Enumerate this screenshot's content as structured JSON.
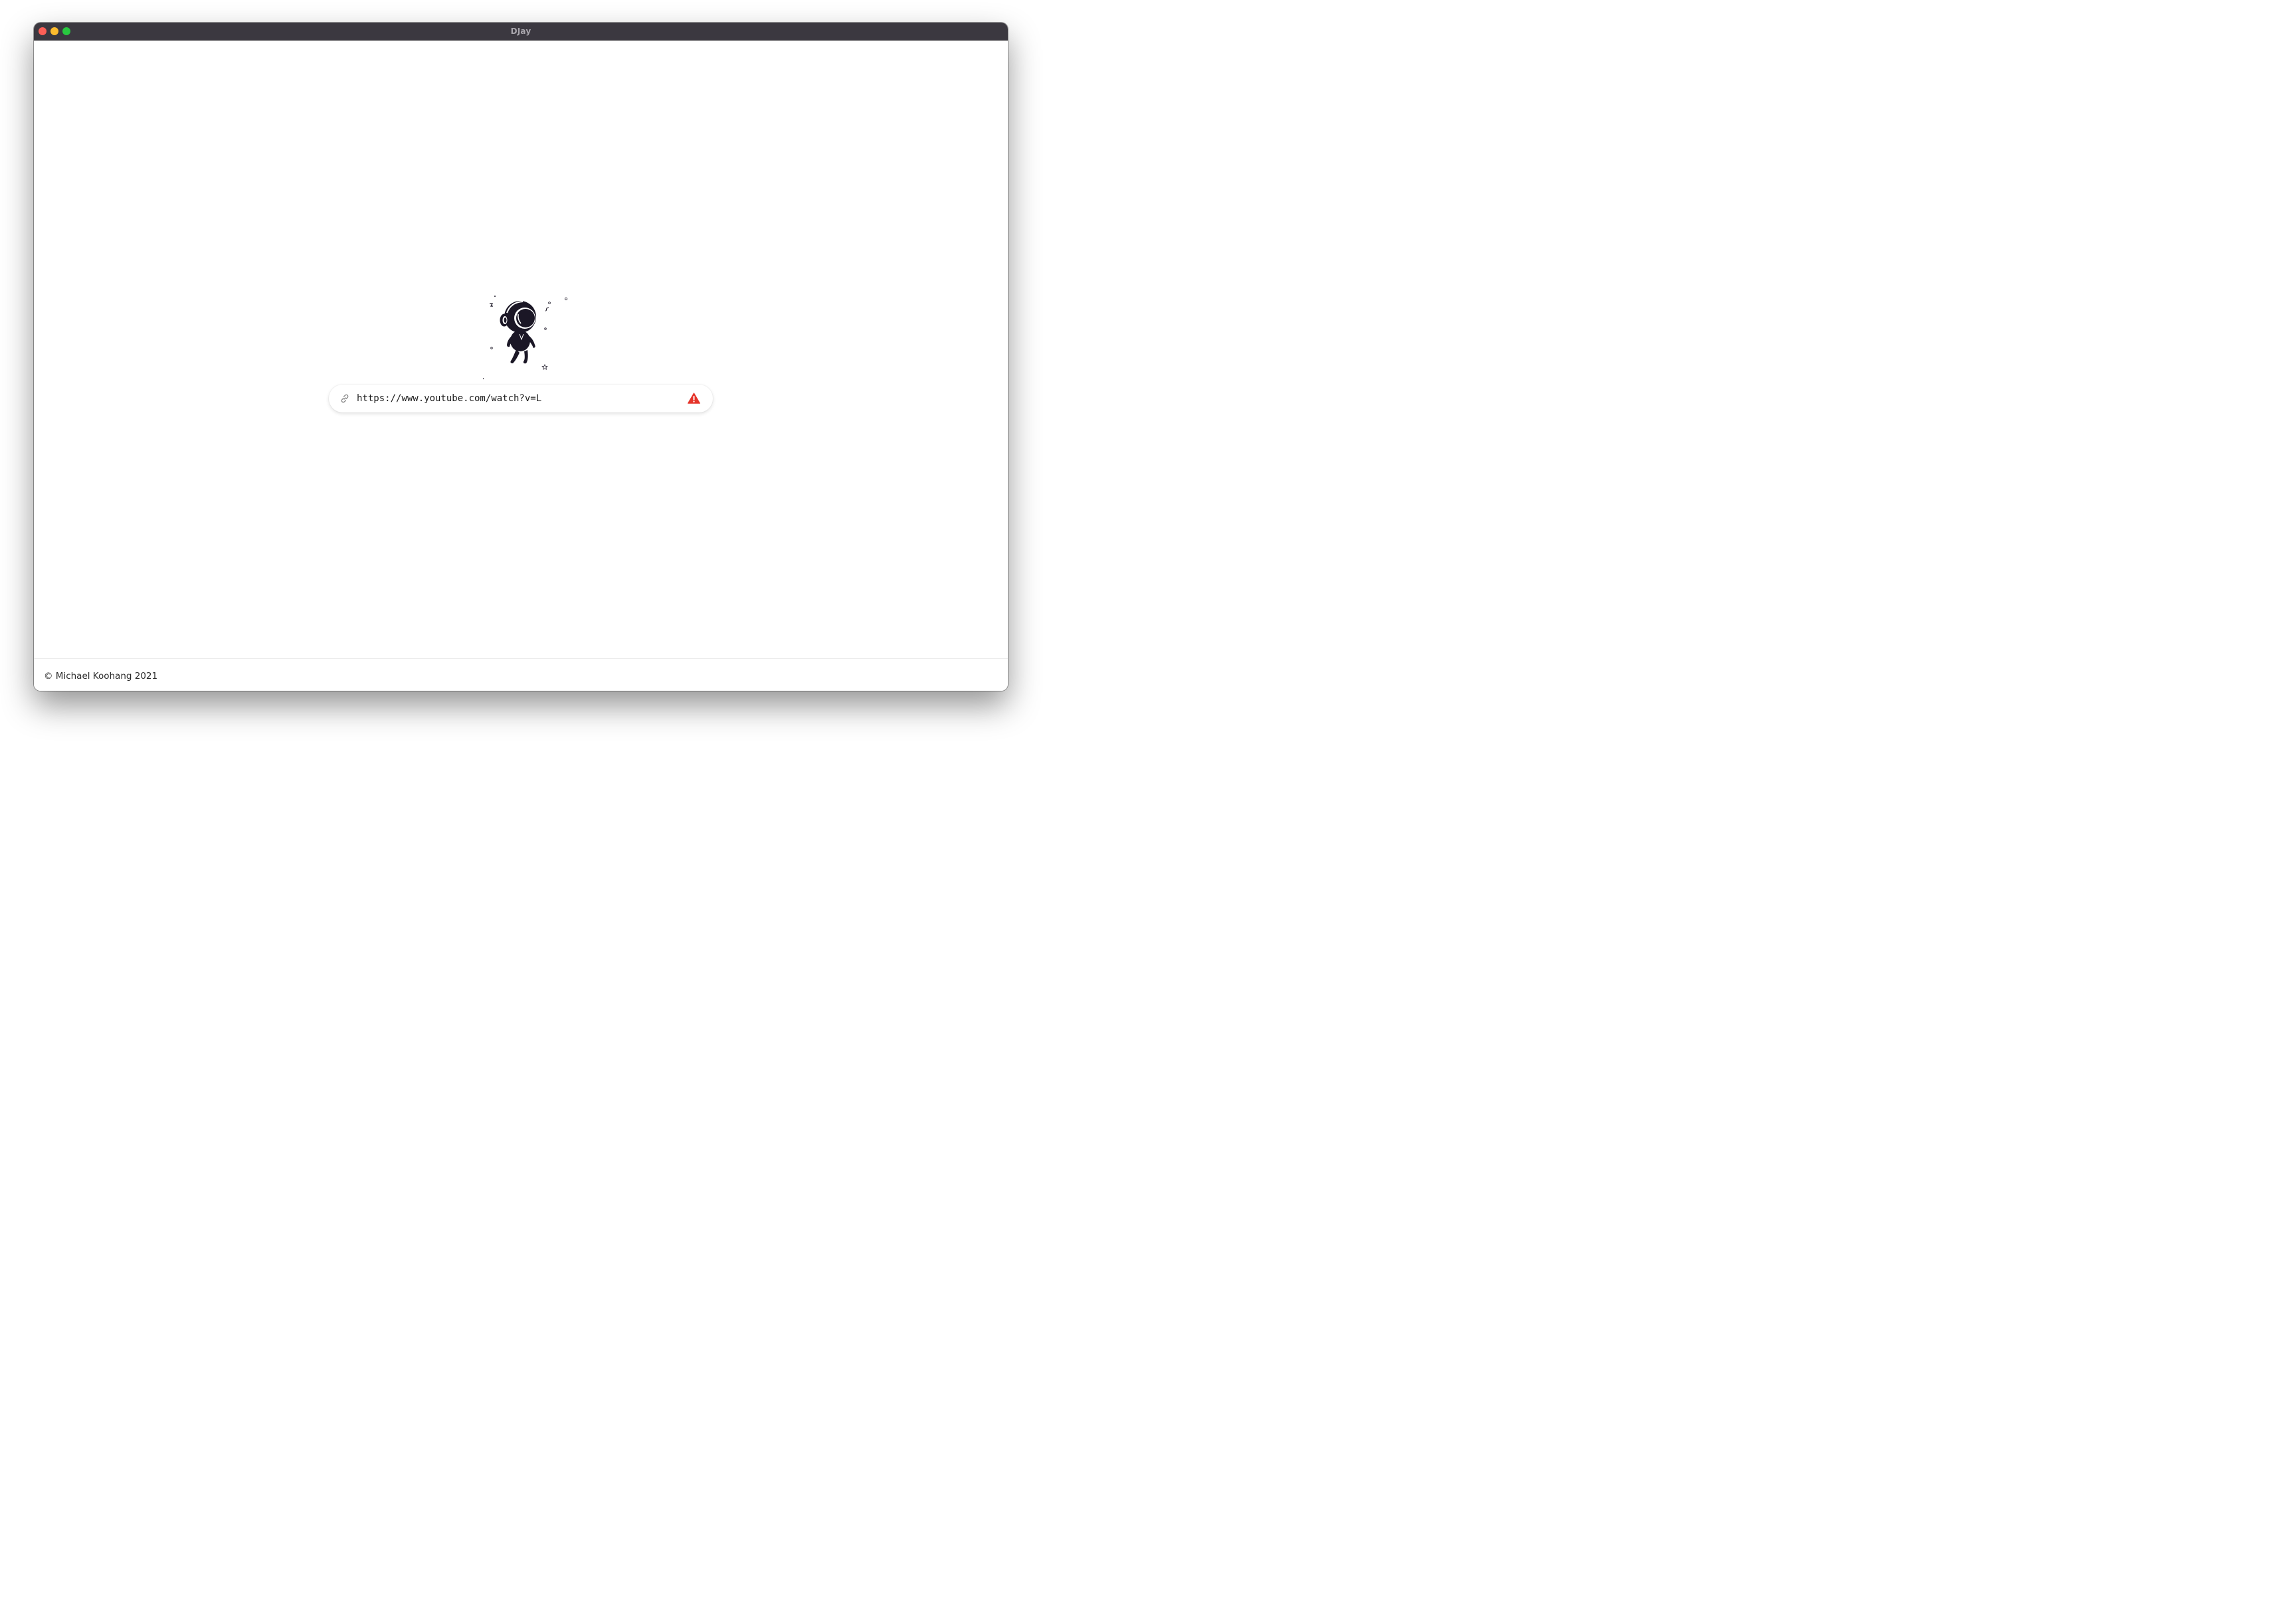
{
  "window": {
    "title": "DJay",
    "controls": [
      "close",
      "minimize",
      "zoom"
    ]
  },
  "mascot": {
    "icon": "astronaut-headphones-icon"
  },
  "url_input": {
    "value": "https://www.youtube.com/watch?v=L",
    "leading_icon": "link-icon",
    "trailing_icon": "warning-icon",
    "warning_color": "#e5352b"
  },
  "footer": {
    "copyright": "© Michael Koohang 2021"
  },
  "colors": {
    "titlebar": "#3b3840",
    "close": "#fe5f57",
    "minimize": "#febc2e",
    "zoom": "#28c840",
    "mascot": "#1b1726"
  }
}
